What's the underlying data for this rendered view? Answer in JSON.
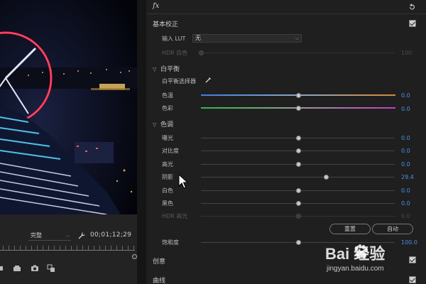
{
  "monitor": {
    "fit_value": "完整",
    "timecode": "00;01;12;29"
  },
  "panel": {
    "fx_label": "fx",
    "basic": {
      "title": "基本校正",
      "lut_label": "输入 LUT",
      "lut_value": "无",
      "hdr_white_label": "HDR 白色",
      "hdr_white_value": "100"
    },
    "white_balance": {
      "title": "白平衡",
      "picker_label": "白平衡选择器",
      "temperature": {
        "label": "色温",
        "value": "0.0",
        "level": 0.5
      },
      "tint": {
        "label": "色彩",
        "value": "0.0",
        "level": 0.5
      }
    },
    "tone": {
      "title": "色调",
      "rows": [
        {
          "label": "曝光",
          "value": "0.0",
          "level": 0.5,
          "dim": false
        },
        {
          "label": "对比度",
          "value": "0.0",
          "level": 0.5,
          "dim": false
        },
        {
          "label": "高光",
          "value": "0.0",
          "level": 0.5,
          "dim": false
        },
        {
          "label": "阴影",
          "value": "29.4",
          "level": 0.645,
          "dim": false
        },
        {
          "label": "白色",
          "value": "0.0",
          "level": 0.5,
          "dim": false
        },
        {
          "label": "黑色",
          "value": "0.0",
          "level": 0.5,
          "dim": false
        },
        {
          "label": "HDR 高光",
          "value": "0.0",
          "level": 0.5,
          "dim": true
        }
      ],
      "reset_label": "重置",
      "auto_label": "自动"
    },
    "saturation": {
      "label": "饱和度",
      "value": "100.0",
      "level": 0.5
    },
    "creative": {
      "title": "创意"
    },
    "curves": {
      "title": "曲线"
    }
  },
  "watermark": {
    "brand": "Bai  经验",
    "url": "jingyan.baidu.com"
  },
  "colors": {
    "accent_value": "#4a90e2",
    "neon_red": "#ff2a4a"
  }
}
